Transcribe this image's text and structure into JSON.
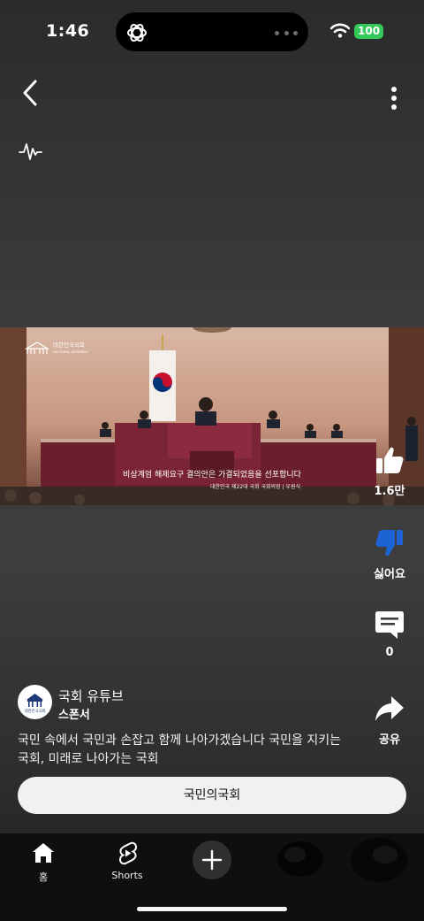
{
  "status_bar": {
    "time": "1:46",
    "battery": "100"
  },
  "video": {
    "overlay_logo_title": "대한민국국회",
    "overlay_logo_subtitle": "NATIONAL ASSEMBLY",
    "subtitle": "비상계엄 해제요구 결의안은 가결되었음을 선포합니다",
    "lower_third": "대한민국 제22대 국회 국회의장 | 우원식"
  },
  "actions": {
    "like_count": "1.6만",
    "dislike_label": "싫어요",
    "comment_count": "0",
    "share_label": "공유"
  },
  "channel": {
    "avatar_text": "대한민국국회",
    "name": "국회 유튜브",
    "sponsor_label": "스폰서",
    "caption": "국민 속에서 국민과 손잡고 함께 나아가겠습니다 국민을 지키는 국회, 미래로 나아가는 국회"
  },
  "cta": {
    "label": "국민의국회"
  },
  "nav": {
    "home_label": "홈",
    "shorts_label": "Shorts"
  },
  "colors": {
    "battery": "#34c759",
    "background": "#3b3d3c",
    "nav_bg": "#0f0f0f"
  }
}
